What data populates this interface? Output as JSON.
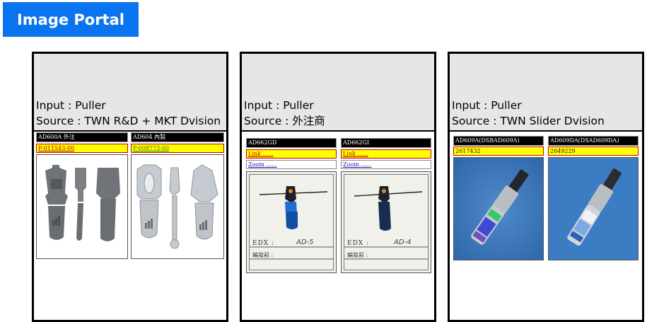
{
  "header": {
    "portal_label": "Image Portal"
  },
  "cards": [
    {
      "input": "Input : Puller",
      "source": "Source : TWN R&D + MKT Dvision",
      "items": [
        {
          "code": "AD600A 外注",
          "link": "P-011543-00"
        },
        {
          "code": "AD604 內製",
          "link": "P-008773-00"
        }
      ]
    },
    {
      "input": "Input : Puller",
      "source": "Source : 外注商",
      "items": [
        {
          "code": "AD662GD",
          "link": "Link ......",
          "zoom": "Zoom ......",
          "edx_label": "EDX :",
          "edx_value": "AD-5",
          "note": "編寫前 :"
        },
        {
          "code": "AD662GI",
          "link": "Link ......",
          "zoom": "Zoom ......",
          "edx_label": "EDX :",
          "edx_value": "AD-4",
          "note": "編寫前 :"
        }
      ]
    },
    {
      "input": "Input : Puller",
      "source": "Source : TWN Slider Dvision",
      "items": [
        {
          "code": "AD609A(DSBAD609A)",
          "link": "2617432"
        },
        {
          "code": "AD609DA(DSAD609DA)",
          "link": "2649229"
        }
      ]
    }
  ]
}
